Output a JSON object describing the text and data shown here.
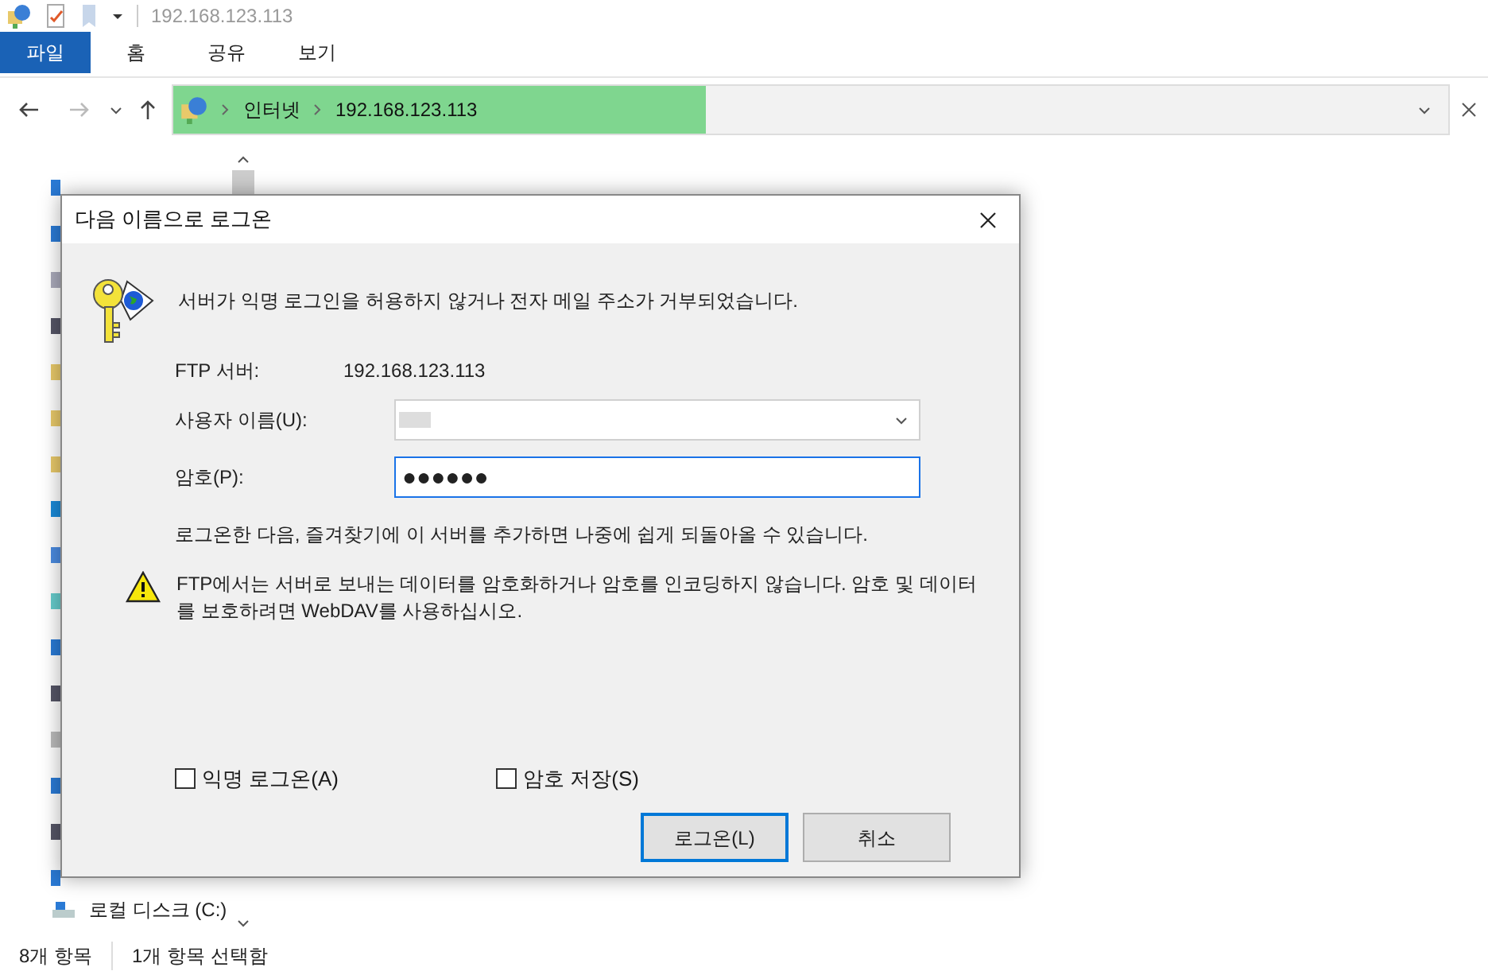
{
  "window": {
    "title": "192.168.123.113"
  },
  "ribbon_tabs": [
    {
      "label": "파일",
      "selected": true
    },
    {
      "label": "홈",
      "selected": false
    },
    {
      "label": "공유",
      "selected": false
    },
    {
      "label": "보기",
      "selected": false
    }
  ],
  "address_bar": {
    "crumbs": [
      "인터넷",
      "192.168.123.113"
    ]
  },
  "nav_pane": {
    "items": [
      {
        "label": "로컬 디스크 (C:)"
      }
    ]
  },
  "status_bar": [
    "8개 항목",
    "1개 항목 선택함"
  ],
  "dialog": {
    "title": "다음 이름으로 로그온",
    "message": "서버가 익명 로그인을 허용하지 않거나 전자 메일 주소가 거부되었습니다.",
    "server_label": "FTP 서버:",
    "server_value": "192.168.123.113",
    "username_label": "사용자 이름(U):",
    "password_label": "암호(P):",
    "password_value": "●●●●●●",
    "hint": "로그온한 다음, 즐겨찾기에 이 서버를 추가하면 나중에 쉽게 되돌아올 수 있습니다.",
    "warning": "FTP에서는 서버로 보내는 데이터를 암호화하거나 암호를 인코딩하지 않습니다. 암호 및 데이터를 보호하려면 WebDAV를 사용하십시오.",
    "checkboxes": [
      {
        "label": "익명 로그온(A)",
        "checked": false
      },
      {
        "label": "암호 저장(S)",
        "checked": false
      }
    ],
    "buttons": [
      {
        "label": "로그온(L)",
        "kind": "default"
      },
      {
        "label": "취소",
        "kind": "normal"
      }
    ]
  }
}
